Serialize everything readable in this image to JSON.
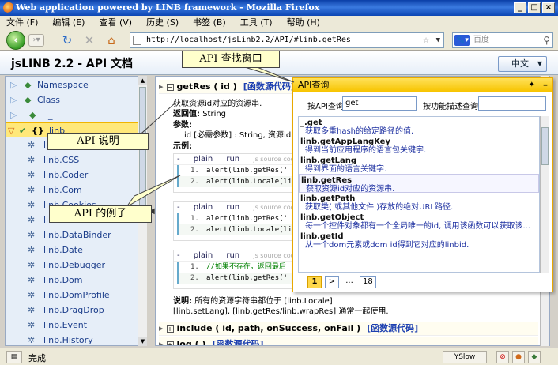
{
  "window": {
    "title": "Web application powered by LINB framework - Mozilla Firefox"
  },
  "menu": [
    "文件 (F)",
    "编辑 (E)",
    "查看 (V)",
    "历史 (S)",
    "书签 (B)",
    "工具 (T)",
    "帮助 (H)"
  ],
  "nav": {
    "url": "http://localhost/jsLinb2.2/API/#linb.getRes",
    "search_placeholder": "百度"
  },
  "app": {
    "title": "jsLINB 2.2 - API 文档",
    "lang": "中文"
  },
  "tree": [
    {
      "label": "Namespace"
    },
    {
      "label": "Class"
    },
    {
      "label": "_"
    },
    {
      "label": "linb"
    },
    {
      "label": "linb.Ajax"
    },
    {
      "label": "linb.CSS"
    },
    {
      "label": "linb.Coder"
    },
    {
      "label": "linb.Com"
    },
    {
      "label": "linb.Cookies"
    },
    {
      "label": "linb.Cookies"
    },
    {
      "label": "linb.DataBinder"
    },
    {
      "label": "linb.Date"
    },
    {
      "label": "linb.Debugger"
    },
    {
      "label": "linb.Dom"
    },
    {
      "label": "linb.DomProfile"
    },
    {
      "label": "linb.DragDrop"
    },
    {
      "label": "linb.Event"
    },
    {
      "label": "linb.History"
    }
  ],
  "doc": {
    "fn_name": "getRes ( id )",
    "src_link": "[函数源代码]",
    "desc": "获取资源id对应的资源串.",
    "return_label": "返回值:",
    "return_val": "String",
    "params_label": "参数:",
    "param_line": "id [必需参数] : String, 资源id.",
    "examples_label": "示例:",
    "code_bar": {
      "minus": "-",
      "plain": "plain",
      "run": "run",
      "tag": "js source code"
    },
    "examples": [
      {
        "lines": [
          "alert(linb.getRes('",
          "alert(linb.Locale[li"
        ]
      },
      {
        "lines": [
          "alert(linb.getRes('",
          "alert(linb.Locale[li"
        ]
      },
      {
        "lines": [
          "//如果不存在，返回最后",
          "alert(linb.getRes('"
        ]
      }
    ],
    "note_label": "说明:",
    "note_1": "所有的资源字符串都位于 [linb.Locale]",
    "note_2": "[linb.setLang], [linb.getRes/linb.wrapRes] 通常一起使用.",
    "fn2": "include ( id, path, onSuccess, onFail )",
    "fn3": "log ( )",
    "src_link_2": "[函数源代码]",
    "src_link_3": "[函数源代码]"
  },
  "popup": {
    "title": "API查询",
    "by_api_label": "按API查询",
    "by_api_value": "get",
    "by_desc_label": "按功能描述查询",
    "by_desc_value": "",
    "results": [
      {
        "t": "_.get",
        "d": "获取多重hash的给定路径的值."
      },
      {
        "t": "linb.getAppLangKey",
        "d": "得到当前应用程序的语言包关键字."
      },
      {
        "t": "linb.getLang",
        "d": "得到界面的语言关键字."
      },
      {
        "t": "linb.getRes",
        "d": "获取资源id对应的资源串."
      },
      {
        "t": "linb.getPath",
        "d": "获取类( 或其他文件 )存放的绝对URL路径."
      },
      {
        "t": "linb.getObject",
        "d": "每一个控件对象都有一个全局唯一的id, 调用该函数可以获取该..."
      },
      {
        "t": "linb.getId",
        "d": "从一个dom元素或dom id得到它对应的linbid."
      }
    ],
    "pager": {
      "current": "1",
      "next": ">",
      "dots": "...",
      "last": "18"
    }
  },
  "callouts": {
    "search_window": "API 查找窗口",
    "api_desc": "API 说明",
    "api_example": "API 的例子"
  },
  "status": {
    "text": "完成",
    "yslow": "YSlow"
  }
}
